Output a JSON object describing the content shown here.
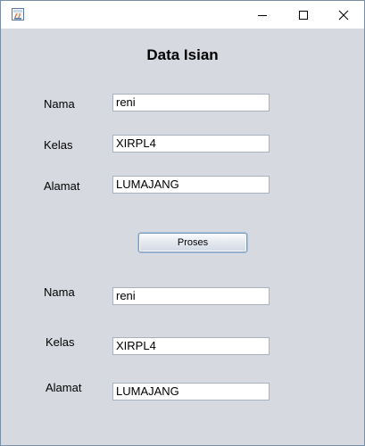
{
  "window": {
    "title": "",
    "controls": {
      "minimize_icon": "minimize-icon",
      "maximize_icon": "maximize-icon",
      "close_icon": "close-icon"
    }
  },
  "form": {
    "title": "Data Isian",
    "input": {
      "nama_label": "Nama",
      "nama_value": "reni",
      "kelas_label": "Kelas",
      "kelas_value": "XIRPL4",
      "alamat_label": "Alamat",
      "alamat_value": "LUMAJANG"
    },
    "proses_label": "Proses",
    "output": {
      "nama_label": "Nama",
      "nama_value": "reni",
      "kelas_label": "Kelas",
      "kelas_value": "XIRPL4",
      "alamat_label": "Alamat",
      "alamat_value": "LUMAJANG"
    }
  }
}
